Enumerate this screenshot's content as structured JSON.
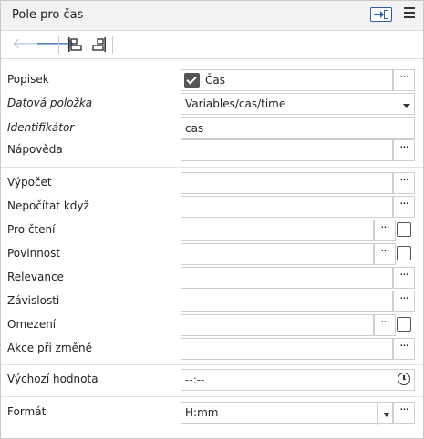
{
  "header": {
    "title": "Pole pro čas"
  },
  "fields": [
    {
      "label": "Popisek",
      "value": "Čas"
    },
    {
      "label": "Datová položka",
      "value": "Variables/cas/time"
    },
    {
      "label": "Identifikátor",
      "value": "cas"
    },
    {
      "label": "Nápověda",
      "value": ""
    },
    {
      "label": "Výpočet",
      "value": ""
    },
    {
      "label": "Nepočítat když",
      "value": ""
    },
    {
      "label": "Pro čtení",
      "value": ""
    },
    {
      "label": "Povinnost",
      "value": ""
    },
    {
      "label": "Relevance",
      "value": ""
    },
    {
      "label": "Závislosti",
      "value": ""
    },
    {
      "label": "Omezení",
      "value": ""
    },
    {
      "label": "Akce při změně",
      "value": ""
    },
    {
      "label": "Výchozí hodnota",
      "value": "--:--"
    },
    {
      "label": "Formát",
      "value": "H:mm"
    }
  ],
  "dots": "···"
}
